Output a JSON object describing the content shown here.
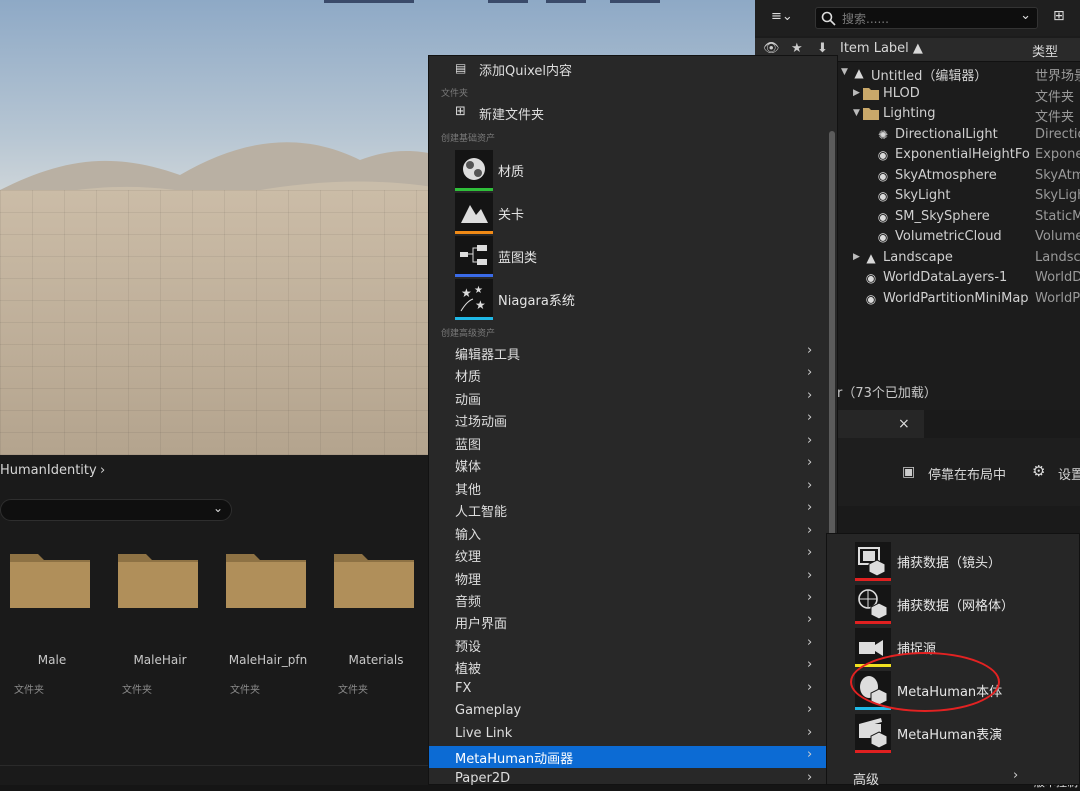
{
  "viewport": {},
  "content_browser": {
    "breadcrumb": "HumanIdentity",
    "breadcrumb_sep": "›",
    "folders": [
      {
        "name": "Male",
        "type": "文件夹"
      },
      {
        "name": "MaleHair",
        "type": "文件夹"
      },
      {
        "name": "MaleHair_pfn",
        "type": "文件夹"
      },
      {
        "name": "Materials",
        "type": "文件夹"
      }
    ]
  },
  "outliner": {
    "search_placeholder": "搜索......",
    "col_label": "Item Label ▲",
    "col_type": "类型",
    "rows": [
      {
        "label": "Untitled（编辑器）",
        "type": "世界场景",
        "indent": 0,
        "icon": "level-icon",
        "expander": "▼"
      },
      {
        "label": "HLOD",
        "type": "文件夹",
        "indent": 1,
        "icon": "folder-icon",
        "expander": "▶"
      },
      {
        "label": "Lighting",
        "type": "文件夹",
        "indent": 1,
        "icon": "folder-open-icon",
        "expander": "▼"
      },
      {
        "label": "DirectionalLight",
        "type": "Directio",
        "indent": 2,
        "icon": "directional-light-icon",
        "expander": ""
      },
      {
        "label": "ExponentialHeightFo",
        "type": "Exponen",
        "indent": 2,
        "icon": "fog-icon",
        "expander": ""
      },
      {
        "label": "SkyAtmosphere",
        "type": "SkyAtm",
        "indent": 2,
        "icon": "sky-atmosphere-icon",
        "expander": ""
      },
      {
        "label": "SkyLight",
        "type": "SkyLigh",
        "indent": 2,
        "icon": "sky-light-icon",
        "expander": ""
      },
      {
        "label": "SM_SkySphere",
        "type": "StaticM",
        "indent": 2,
        "icon": "static-mesh-icon",
        "expander": ""
      },
      {
        "label": "VolumetricCloud",
        "type": "Volume",
        "indent": 2,
        "icon": "cloud-icon",
        "expander": ""
      },
      {
        "label": "Landscape",
        "type": "Landsca",
        "indent": 1,
        "icon": "landscape-icon",
        "expander": "▶"
      },
      {
        "label": "WorldDataLayers-1",
        "type": "WorldD",
        "indent": 1,
        "icon": "world-data-icon",
        "expander": ""
      },
      {
        "label": "WorldPartitionMiniMap",
        "type": "WorldP",
        "indent": 1,
        "icon": "world-partition-icon",
        "expander": ""
      }
    ],
    "status": "r（73个已加载）"
  },
  "details": {
    "tab_close": "×",
    "dock_label": "停靠在布局中",
    "settings_label": "设置",
    "bottom_hint": "版本控制"
  },
  "menu": {
    "add_quixel": "添加Quixel内容",
    "section_folder": "文件夹",
    "new_folder": "新建文件夹",
    "section_basic": "创建基础资产",
    "basic_assets": [
      {
        "label": "材质",
        "line_color": "#2fbf3a"
      },
      {
        "label": "关卡",
        "line_color": "#f08a16"
      },
      {
        "label": "蓝图类",
        "line_color": "#3a6be8"
      },
      {
        "label": "Niagara系统",
        "line_color": "#1fb8e6"
      }
    ],
    "section_advanced": "创建高级资产",
    "advanced_items": [
      "编辑器工具",
      "材质",
      "动画",
      "过场动画",
      "蓝图",
      "媒体",
      "其他",
      "人工智能",
      "输入",
      "纹理",
      "物理",
      "音频",
      "用户界面",
      "预设",
      "植被",
      "FX",
      "Gameplay",
      "Live Link",
      "MetaHuman动画器",
      "Paper2D"
    ],
    "selected_item": "MetaHuman动画器",
    "arrow": "›"
  },
  "submenu": {
    "items": [
      {
        "label": "捕获数据（镜头）",
        "line_color": "#e02020"
      },
      {
        "label": "捕获数据（网格体）",
        "line_color": "#e02020"
      },
      {
        "label": "捕捉源",
        "line_color": "#f0e020"
      },
      {
        "label": "MetaHuman本体",
        "line_color": "#1fb8e6"
      },
      {
        "label": "MetaHuman表演",
        "line_color": "#e02020"
      }
    ],
    "advanced": "高级"
  }
}
